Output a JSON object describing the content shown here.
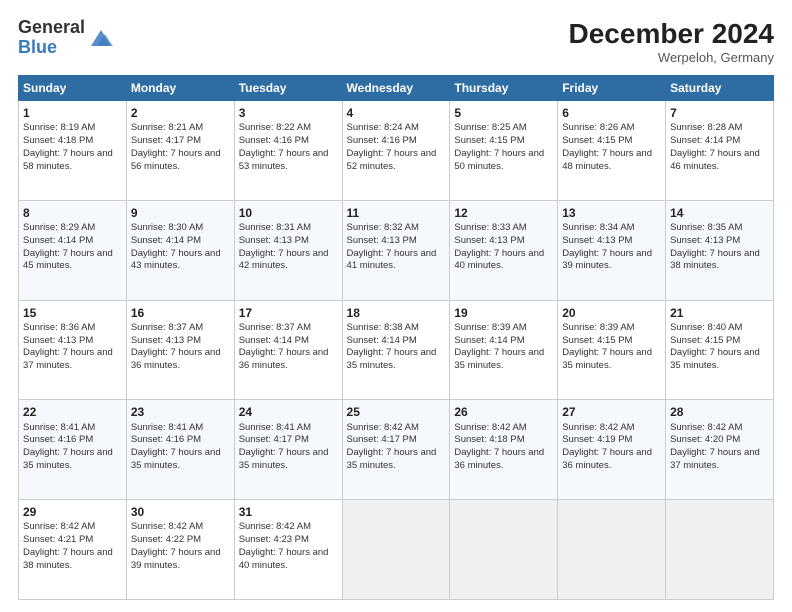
{
  "header": {
    "logo_line1": "General",
    "logo_line2": "Blue",
    "month_title": "December 2024",
    "location": "Werpeloh, Germany"
  },
  "days_of_week": [
    "Sunday",
    "Monday",
    "Tuesday",
    "Wednesday",
    "Thursday",
    "Friday",
    "Saturday"
  ],
  "weeks": [
    [
      {
        "day": 1,
        "sunrise": "Sunrise: 8:19 AM",
        "sunset": "Sunset: 4:18 PM",
        "daylight": "Daylight: 7 hours and 58 minutes."
      },
      {
        "day": 2,
        "sunrise": "Sunrise: 8:21 AM",
        "sunset": "Sunset: 4:17 PM",
        "daylight": "Daylight: 7 hours and 56 minutes."
      },
      {
        "day": 3,
        "sunrise": "Sunrise: 8:22 AM",
        "sunset": "Sunset: 4:16 PM",
        "daylight": "Daylight: 7 hours and 53 minutes."
      },
      {
        "day": 4,
        "sunrise": "Sunrise: 8:24 AM",
        "sunset": "Sunset: 4:16 PM",
        "daylight": "Daylight: 7 hours and 52 minutes."
      },
      {
        "day": 5,
        "sunrise": "Sunrise: 8:25 AM",
        "sunset": "Sunset: 4:15 PM",
        "daylight": "Daylight: 7 hours and 50 minutes."
      },
      {
        "day": 6,
        "sunrise": "Sunrise: 8:26 AM",
        "sunset": "Sunset: 4:15 PM",
        "daylight": "Daylight: 7 hours and 48 minutes."
      },
      {
        "day": 7,
        "sunrise": "Sunrise: 8:28 AM",
        "sunset": "Sunset: 4:14 PM",
        "daylight": "Daylight: 7 hours and 46 minutes."
      }
    ],
    [
      {
        "day": 8,
        "sunrise": "Sunrise: 8:29 AM",
        "sunset": "Sunset: 4:14 PM",
        "daylight": "Daylight: 7 hours and 45 minutes."
      },
      {
        "day": 9,
        "sunrise": "Sunrise: 8:30 AM",
        "sunset": "Sunset: 4:14 PM",
        "daylight": "Daylight: 7 hours and 43 minutes."
      },
      {
        "day": 10,
        "sunrise": "Sunrise: 8:31 AM",
        "sunset": "Sunset: 4:13 PM",
        "daylight": "Daylight: 7 hours and 42 minutes."
      },
      {
        "day": 11,
        "sunrise": "Sunrise: 8:32 AM",
        "sunset": "Sunset: 4:13 PM",
        "daylight": "Daylight: 7 hours and 41 minutes."
      },
      {
        "day": 12,
        "sunrise": "Sunrise: 8:33 AM",
        "sunset": "Sunset: 4:13 PM",
        "daylight": "Daylight: 7 hours and 40 minutes."
      },
      {
        "day": 13,
        "sunrise": "Sunrise: 8:34 AM",
        "sunset": "Sunset: 4:13 PM",
        "daylight": "Daylight: 7 hours and 39 minutes."
      },
      {
        "day": 14,
        "sunrise": "Sunrise: 8:35 AM",
        "sunset": "Sunset: 4:13 PM",
        "daylight": "Daylight: 7 hours and 38 minutes."
      }
    ],
    [
      {
        "day": 15,
        "sunrise": "Sunrise: 8:36 AM",
        "sunset": "Sunset: 4:13 PM",
        "daylight": "Daylight: 7 hours and 37 minutes."
      },
      {
        "day": 16,
        "sunrise": "Sunrise: 8:37 AM",
        "sunset": "Sunset: 4:13 PM",
        "daylight": "Daylight: 7 hours and 36 minutes."
      },
      {
        "day": 17,
        "sunrise": "Sunrise: 8:37 AM",
        "sunset": "Sunset: 4:14 PM",
        "daylight": "Daylight: 7 hours and 36 minutes."
      },
      {
        "day": 18,
        "sunrise": "Sunrise: 8:38 AM",
        "sunset": "Sunset: 4:14 PM",
        "daylight": "Daylight: 7 hours and 35 minutes."
      },
      {
        "day": 19,
        "sunrise": "Sunrise: 8:39 AM",
        "sunset": "Sunset: 4:14 PM",
        "daylight": "Daylight: 7 hours and 35 minutes."
      },
      {
        "day": 20,
        "sunrise": "Sunrise: 8:39 AM",
        "sunset": "Sunset: 4:15 PM",
        "daylight": "Daylight: 7 hours and 35 minutes."
      },
      {
        "day": 21,
        "sunrise": "Sunrise: 8:40 AM",
        "sunset": "Sunset: 4:15 PM",
        "daylight": "Daylight: 7 hours and 35 minutes."
      }
    ],
    [
      {
        "day": 22,
        "sunrise": "Sunrise: 8:41 AM",
        "sunset": "Sunset: 4:16 PM",
        "daylight": "Daylight: 7 hours and 35 minutes."
      },
      {
        "day": 23,
        "sunrise": "Sunrise: 8:41 AM",
        "sunset": "Sunset: 4:16 PM",
        "daylight": "Daylight: 7 hours and 35 minutes."
      },
      {
        "day": 24,
        "sunrise": "Sunrise: 8:41 AM",
        "sunset": "Sunset: 4:17 PM",
        "daylight": "Daylight: 7 hours and 35 minutes."
      },
      {
        "day": 25,
        "sunrise": "Sunrise: 8:42 AM",
        "sunset": "Sunset: 4:17 PM",
        "daylight": "Daylight: 7 hours and 35 minutes."
      },
      {
        "day": 26,
        "sunrise": "Sunrise: 8:42 AM",
        "sunset": "Sunset: 4:18 PM",
        "daylight": "Daylight: 7 hours and 36 minutes."
      },
      {
        "day": 27,
        "sunrise": "Sunrise: 8:42 AM",
        "sunset": "Sunset: 4:19 PM",
        "daylight": "Daylight: 7 hours and 36 minutes."
      },
      {
        "day": 28,
        "sunrise": "Sunrise: 8:42 AM",
        "sunset": "Sunset: 4:20 PM",
        "daylight": "Daylight: 7 hours and 37 minutes."
      }
    ],
    [
      {
        "day": 29,
        "sunrise": "Sunrise: 8:42 AM",
        "sunset": "Sunset: 4:21 PM",
        "daylight": "Daylight: 7 hours and 38 minutes."
      },
      {
        "day": 30,
        "sunrise": "Sunrise: 8:42 AM",
        "sunset": "Sunset: 4:22 PM",
        "daylight": "Daylight: 7 hours and 39 minutes."
      },
      {
        "day": 31,
        "sunrise": "Sunrise: 8:42 AM",
        "sunset": "Sunset: 4:23 PM",
        "daylight": "Daylight: 7 hours and 40 minutes."
      },
      null,
      null,
      null,
      null
    ]
  ]
}
